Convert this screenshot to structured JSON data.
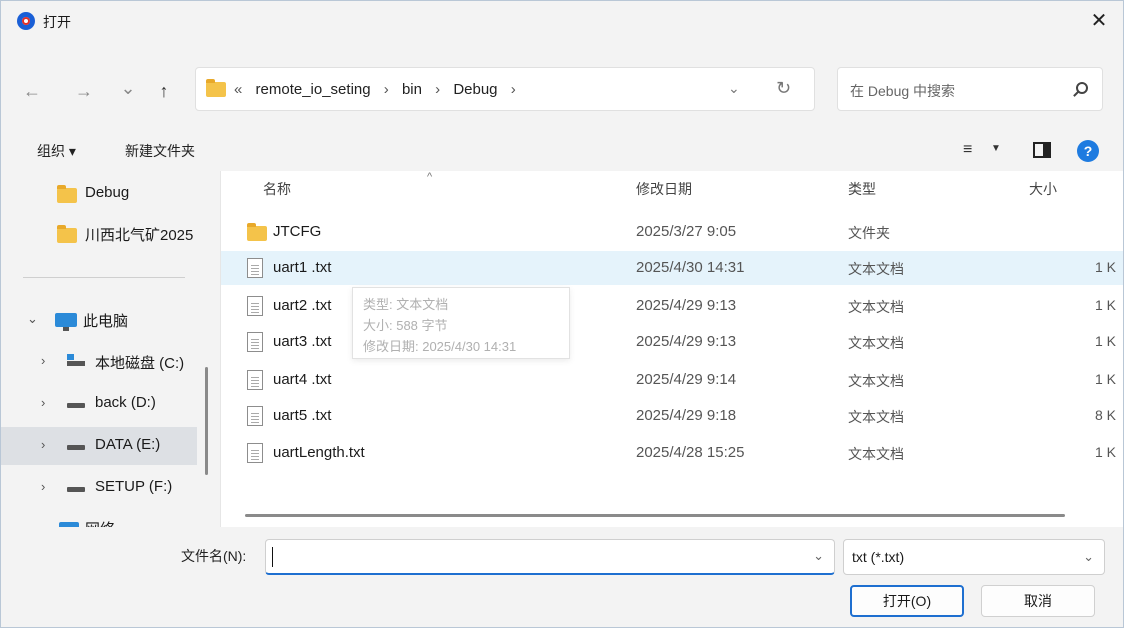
{
  "window": {
    "title": "打开",
    "close_glyph": "✕"
  },
  "nav": {
    "back_glyph": "←",
    "forward_glyph": "→",
    "recent_glyph": "⌄",
    "up_glyph": "↑",
    "crumb_prefix": "«",
    "crumbs": [
      "remote_io_seting",
      "bin",
      "Debug"
    ],
    "crumb_separator": "›",
    "address_dropdown_glyph": "⌄",
    "refresh_glyph": "↻",
    "search_placeholder": "在 Debug 中搜索"
  },
  "toolbar": {
    "organize_label": "组织 ▾",
    "new_folder_label": "新建文件夹",
    "view_glyph": "≡",
    "view_dropdown_glyph": "▼",
    "help_glyph": "?"
  },
  "sidebar": {
    "items": [
      {
        "label": "Debug",
        "icon": "folder-icon"
      },
      {
        "label": "川西北气矿2025",
        "icon": "folder-icon"
      },
      {
        "label": "此电脑",
        "icon": "computer-icon",
        "expanded": true
      },
      {
        "label": "本地磁盘 (C:)",
        "icon": "drive-icon"
      },
      {
        "label": "back (D:)",
        "icon": "drive-icon"
      },
      {
        "label": "DATA (E:)",
        "icon": "drive-icon",
        "selected": true
      },
      {
        "label": "SETUP (F:)",
        "icon": "drive-icon"
      },
      {
        "label": "网络",
        "icon": "network-icon"
      }
    ],
    "expanded_glyph": "⌄",
    "collapsed_glyph": "›"
  },
  "file_list": {
    "columns": [
      "名称",
      "修改日期",
      "类型",
      "大小"
    ],
    "sort_glyph": "^",
    "rows": [
      {
        "name": "JTCFG",
        "date": "2025/3/27 9:05",
        "type": "文件夹",
        "size": "",
        "icon": "folder-icon"
      },
      {
        "name": "uart1 .txt",
        "date": "2025/4/30 14:31",
        "type": "文本文档",
        "size": "1 K",
        "icon": "text-file-icon",
        "hover": true
      },
      {
        "name": "uart2 .txt",
        "date": "2025/4/29 9:13",
        "type": "文本文档",
        "size": "1 K",
        "icon": "text-file-icon"
      },
      {
        "name": "uart3 .txt",
        "date": "2025/4/29 9:13",
        "type": "文本文档",
        "size": "1 K",
        "icon": "text-file-icon"
      },
      {
        "name": "uart4 .txt",
        "date": "2025/4/29 9:14",
        "type": "文本文档",
        "size": "1 K",
        "icon": "text-file-icon"
      },
      {
        "name": "uart5 .txt",
        "date": "2025/4/29 9:18",
        "type": "文本文档",
        "size": "8 K",
        "icon": "text-file-icon"
      },
      {
        "name": "uartLength.txt",
        "date": "2025/4/28 15:25",
        "type": "文本文档",
        "size": "1 K",
        "icon": "text-file-icon"
      }
    ],
    "tooltip": {
      "type_line": "类型: 文本文档",
      "size_line": "大小: 588 字节",
      "date_line": "修改日期: 2025/4/30 14:31"
    }
  },
  "bottom": {
    "filename_label": "文件名(N):",
    "filename_value": "",
    "filename_dropdown_glyph": "⌄",
    "filter_value": "txt (*.txt)",
    "filter_dropdown_glyph": "⌄",
    "open_label": "打开(O)",
    "cancel_label": "取消"
  },
  "colors": {
    "accent": "#1e6fd0",
    "hover_row": "#e5f3fb",
    "selected_side": "#dde0e4",
    "folder": "#f4c34a"
  }
}
